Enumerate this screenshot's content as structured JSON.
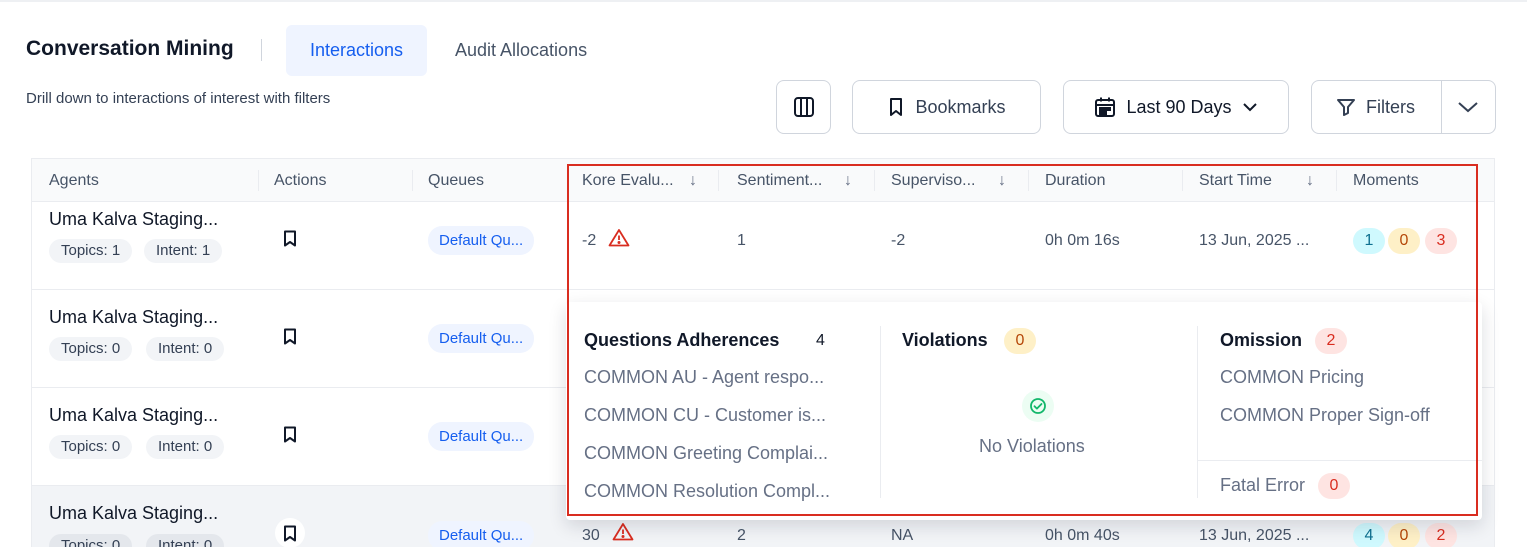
{
  "app": {
    "title": "Conversation Mining",
    "subtitle": "Drill down to interactions of interest with filters"
  },
  "tabs": [
    {
      "label": "Interactions",
      "active": true
    },
    {
      "label": "Audit Allocations",
      "active": false
    }
  ],
  "toolbar": {
    "columns_icon": "columns-icon",
    "bookmarks_label": "Bookmarks",
    "date_label": "Last 90 Days",
    "filters_label": "Filters"
  },
  "table": {
    "headers": {
      "agents": "Agents",
      "actions": "Actions",
      "queues": "Queues",
      "kore": "Kore Evalu...",
      "sentiment": "Sentiment...",
      "supervisor": "Superviso...",
      "duration": "Duration",
      "start_time": "Start Time",
      "moments": "Moments"
    },
    "rows": [
      {
        "agent": "Uma Kalva Staging...",
        "topics": "Topics: 1",
        "intent": "Intent: 1",
        "queue": "Default Qu...",
        "kore": "-2",
        "sentiment": "1",
        "supervisor": "-2",
        "duration": "0h 0m 16s",
        "start": "13 Jun, 2025 ...",
        "m1": "1",
        "m2": "0",
        "m3": "3"
      },
      {
        "agent": "Uma Kalva Staging...",
        "topics": "Topics: 0",
        "intent": "Intent: 0",
        "queue": "Default Qu..."
      },
      {
        "agent": "Uma Kalva Staging...",
        "topics": "Topics: 0",
        "intent": "Intent: 0",
        "queue": "Default Qu..."
      },
      {
        "agent": "Uma Kalva Staging...",
        "topics": "Topics: 0",
        "intent": "Intent: 0",
        "queue": "Default Qu...",
        "kore": "30",
        "sentiment": "2",
        "supervisor": "NA",
        "duration": "0h 0m 40s",
        "start": "13 Jun, 2025 ...",
        "m1": "4",
        "m2": "0",
        "m3": "2"
      }
    ]
  },
  "popover": {
    "adherence": {
      "title": "Questions Adherences",
      "count": "4",
      "items": [
        "COMMON AU - Agent respo...",
        "COMMON CU - Customer is...",
        "COMMON Greeting Complai...",
        "COMMON Resolution Compl..."
      ]
    },
    "violations": {
      "title": "Violations",
      "count": "0",
      "empty": "No Violations"
    },
    "omission": {
      "title": "Omission",
      "count": "2",
      "items": [
        "COMMON Pricing",
        "COMMON Proper Sign-off"
      ]
    },
    "fatal": {
      "title": "Fatal Error",
      "count": "0"
    }
  },
  "colors": {
    "accent": "#155eef",
    "highlight_border": "#d92d20",
    "warning": "#d92d20"
  }
}
